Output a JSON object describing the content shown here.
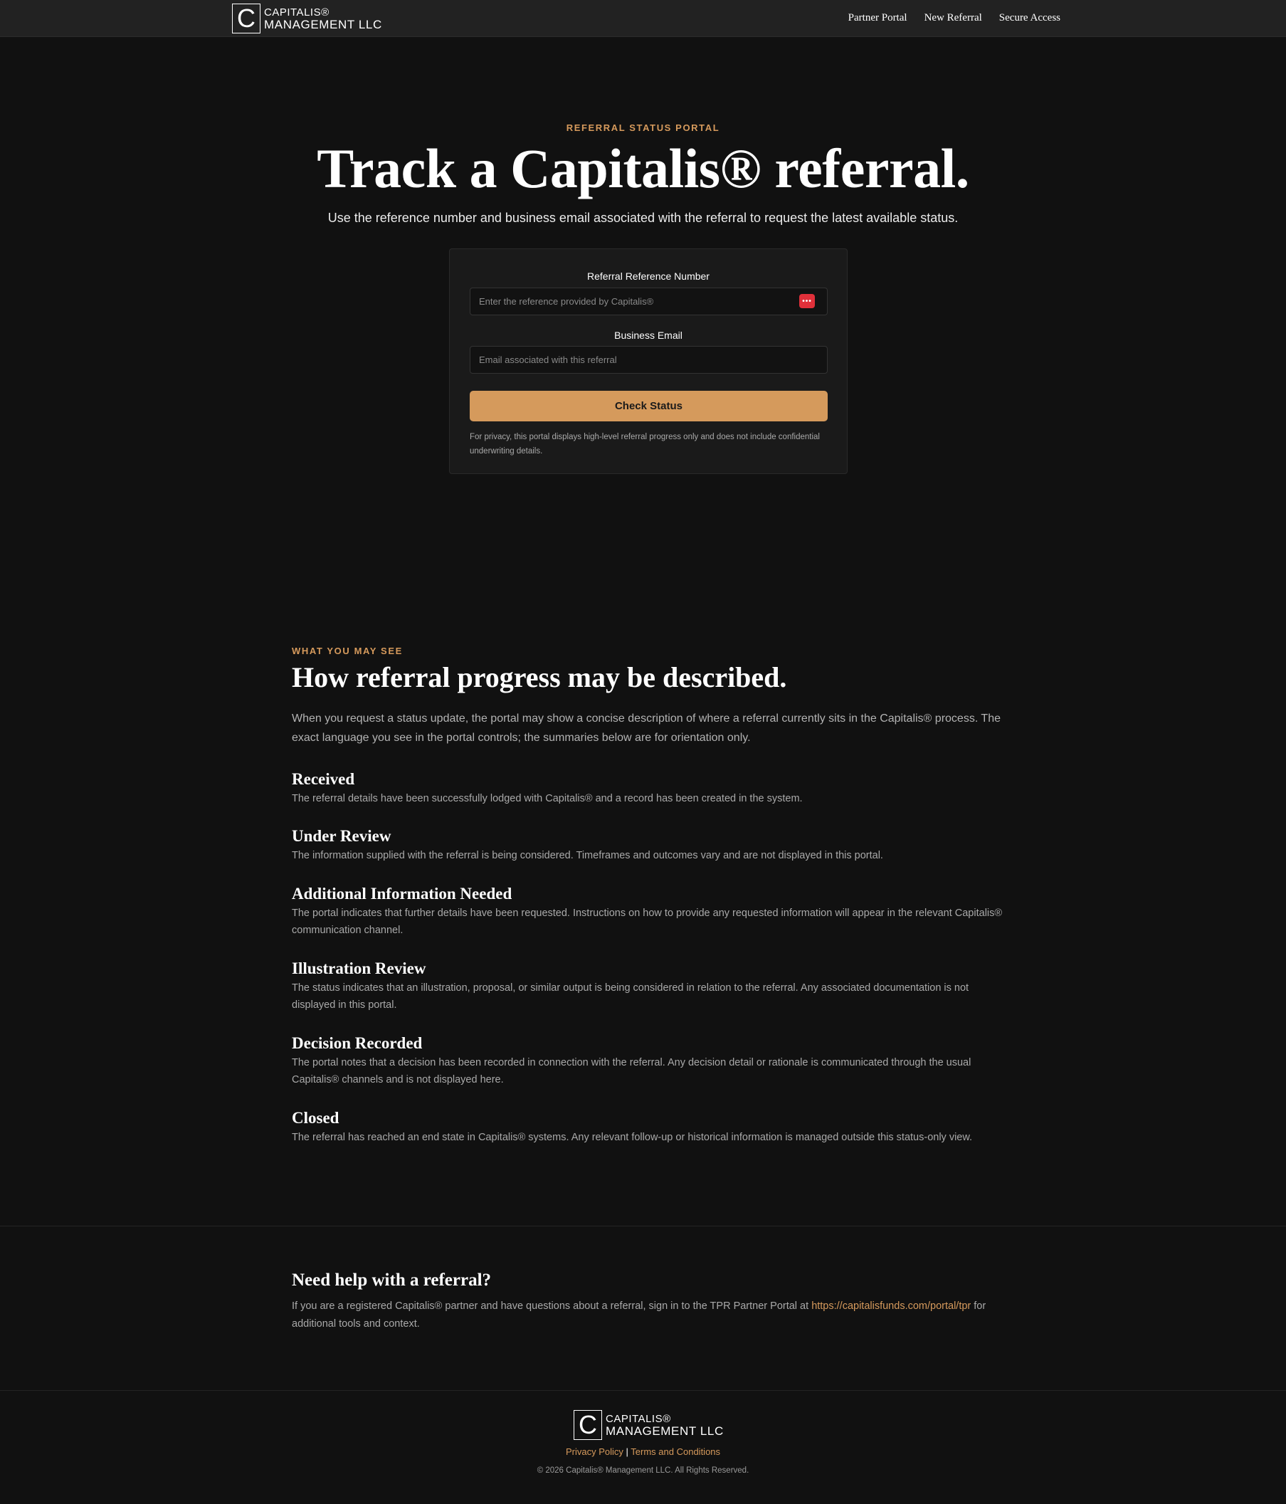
{
  "brand": {
    "mark": "C",
    "line1": "CAPITALIS®",
    "line2": "MANAGEMENT LLC"
  },
  "nav": {
    "items": [
      "Partner Portal",
      "New Referral",
      "Secure Access"
    ]
  },
  "hero": {
    "eyebrow": "REFERRAL STATUS PORTAL",
    "title": "Track a Capitalis® referral.",
    "subtitle": "Use the reference number and business email associated with the referral to request the latest available status."
  },
  "form": {
    "reference_label": "Referral Reference Number",
    "reference_placeholder": "Enter the reference provided by Capitalis®",
    "reference_value": "",
    "email_label": "Business Email",
    "email_placeholder": "Email associated with this referral",
    "email_value": "",
    "submit_label": "Check Status",
    "privacy_note": "For privacy, this portal displays high-level referral progress only and does not include confidential underwriting details.",
    "password_manager_icon": "more-dots-icon",
    "password_manager_glyph": "•••"
  },
  "statuses_section": {
    "eyebrow": "WHAT YOU MAY SEE",
    "title": "How referral progress may be described.",
    "intro": "When you request a status update, the portal may show a concise description of where a referral currently sits in the Capitalis® process. The exact language you see in the portal controls; the summaries below are for orientation only.",
    "items": [
      {
        "title": "Received",
        "description": "The referral details have been successfully lodged with Capitalis® and a record has been created in the system."
      },
      {
        "title": "Under Review",
        "description": "The information supplied with the referral is being considered. Timeframes and outcomes vary and are not displayed in this portal."
      },
      {
        "title": "Additional Information Needed",
        "description": "The portal indicates that further details have been requested. Instructions on how to provide any requested information will appear in the relevant Capitalis® communication channel."
      },
      {
        "title": "Illustration Review",
        "description": "The status indicates that an illustration, proposal, or similar output is being considered in relation to the referral. Any associated documentation is not displayed in this portal."
      },
      {
        "title": "Decision Recorded",
        "description": "The portal notes that a decision has been recorded in connection with the referral. Any decision detail or rationale is communicated through the usual Capitalis® channels and is not displayed here."
      },
      {
        "title": "Closed",
        "description": "The referral has reached an end state in Capitalis® systems. Any relevant follow-up or historical information is managed outside this status-only view."
      }
    ]
  },
  "help": {
    "title": "Need help with a referral?",
    "text_before": "If you are a registered Capitalis® partner and have questions about a referral, sign in to the TPR Partner Portal at ",
    "link": "https://capitalisfunds.com/portal/tpr",
    "text_after": " for additional tools and context."
  },
  "footer": {
    "privacy_link": "Privacy Policy",
    "separator": "|",
    "terms_link": "Terms and Conditions",
    "copyright": "© 2026 Capitalis® Management LLC. All Rights Reserved."
  },
  "colors": {
    "accent": "#d69a5c",
    "background": "#111111",
    "header": "#222222",
    "card": "#1a1a1a",
    "password_icon": "#e0303a"
  }
}
